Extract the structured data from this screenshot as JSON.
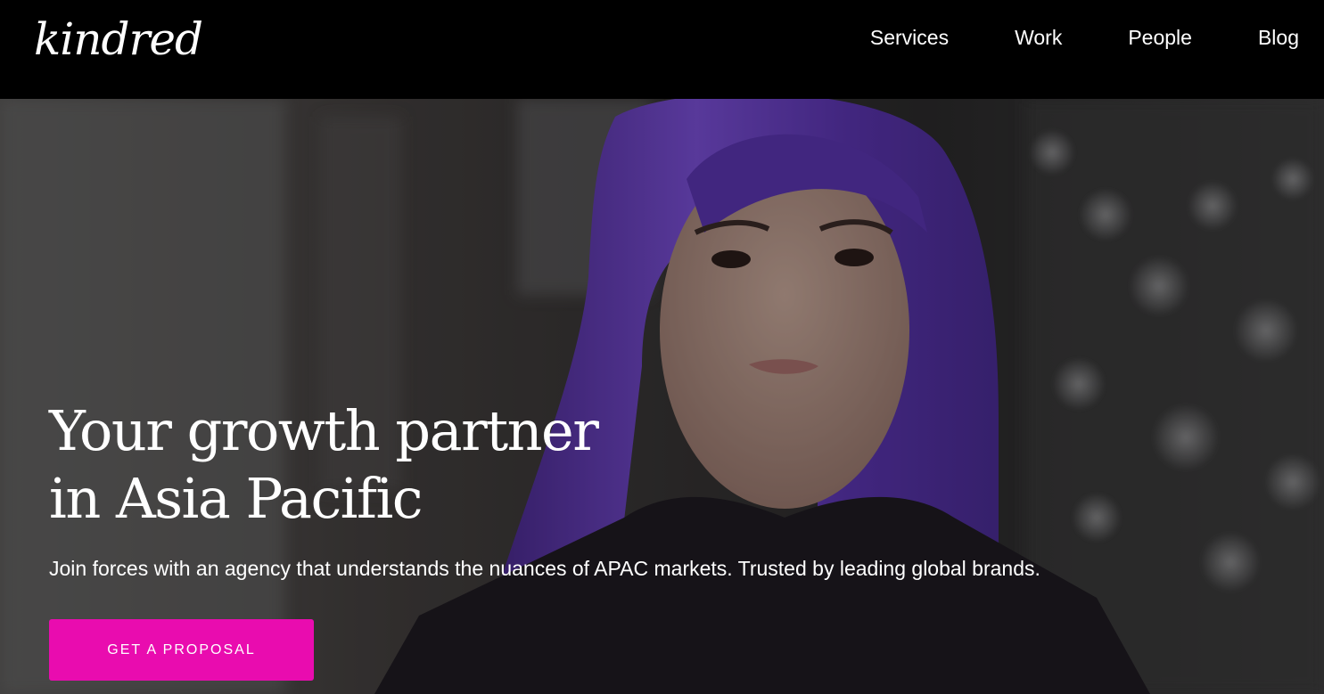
{
  "header": {
    "logo_text": "kindred",
    "nav": [
      {
        "label": "Services"
      },
      {
        "label": "Work"
      },
      {
        "label": "People"
      },
      {
        "label": "Blog"
      }
    ]
  },
  "hero": {
    "headline_line1": "Your growth partner",
    "headline_line2": "in Asia Pacific",
    "subline": "Join forces with an agency that understands the nuances of APAC markets. Trusted by leading global brands.",
    "cta_label": "GET A PROPOSAL",
    "colors": {
      "cta": "#e90caf",
      "hair": "#6d42c9"
    }
  }
}
